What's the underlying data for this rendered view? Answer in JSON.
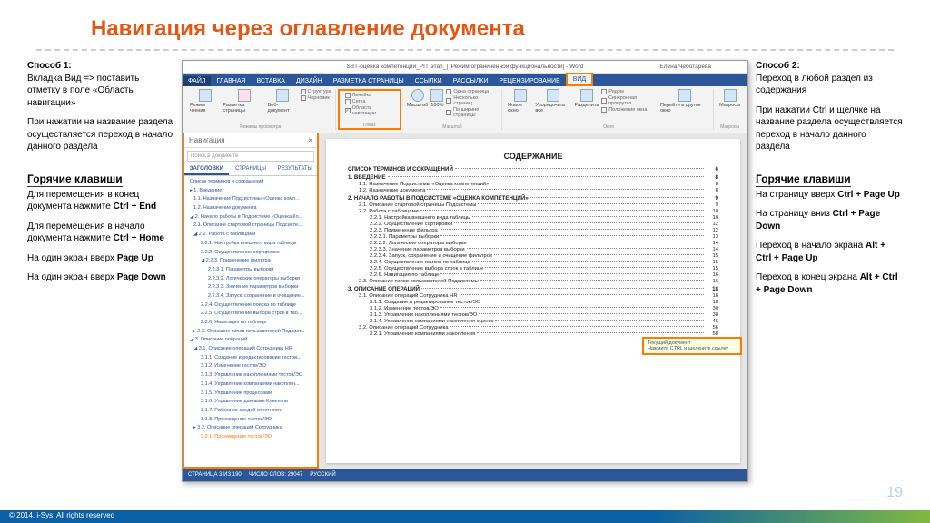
{
  "title": "Навигация через оглавление документа",
  "left": {
    "h1": "Способ 1:",
    "p1": "Вкладка Вид => поставить отметку в поле «Область навигации»",
    "p2": "При нажатии на название раздела осуществляется переход в начало данного раздела",
    "hk": "Горячие клавиши",
    "p3a": "Для перемещения в конец документа нажмите ",
    "p3b": "Ctrl + End",
    "p4a": "Для перемещения в начало документа нажмите ",
    "p4b": "Ctrl + Home",
    "p5a": "На один экран вверх ",
    "p5b": "Page Up",
    "p6a": "На один экран вверх ",
    "p6b": "Page Down"
  },
  "right": {
    "h1": "Способ 2:",
    "p1": "Переход в любой раздел из содержания",
    "p2": "При нажатии Ctrl и щелчке на название раздела осуществляется переход в начало данного раздела",
    "hk": "Горячие клавиши",
    "p3a": "На страницу вверх ",
    "p3b": "Ctrl + Page Up",
    "p4a": "На страницу вниз ",
    "p4b": "Ctrl + Page Down",
    "p5a": "Переход в начало экрана ",
    "p5b": "Alt + Ctrl + Page Up",
    "p6a": "Переход в конец экрана ",
    "p6b": "Alt + Ctrl + Page Down"
  },
  "word": {
    "title": "SBТ-оценка компетенций_РП [этап_] [Режим ограниченной функциональности] - Word",
    "user": "Елена Чеботарева",
    "tabs": [
      "ФАЙЛ",
      "ГЛАВНАЯ",
      "ВСТАВКА",
      "ДИЗАЙН",
      "РАЗМЕТКА СТРАНИЦЫ",
      "ССЫЛКИ",
      "РАССЫЛКИ",
      "РЕЦЕНЗИРОВАНИЕ",
      "ВИД"
    ],
    "group1_btns": [
      "Режим чтения",
      "Разметка страницы",
      "Веб-документ"
    ],
    "group1_checks": [
      "Структура",
      "Черновик"
    ],
    "group2_checks": [
      "Линейка",
      "Сетка",
      "Область навигации"
    ],
    "group2_label": "Показ",
    "group1_label": "Режимы просмотра",
    "zoom_label": "Масштаб",
    "zoom_btns": [
      "Масштаб",
      "100%"
    ],
    "page_checks": [
      "Одна страница",
      "Несколько страниц",
      "По ширине страницы"
    ],
    "window_btns": [
      "Новое окно",
      "Упорядочить все",
      "Разделить"
    ],
    "window_checks": [
      "Рядом",
      "Синхронная прокрутка",
      "Положение окна"
    ],
    "switch_btn": "Перейти в другое окно",
    "macros_btn": "Макросы",
    "window_label": "Окно",
    "macros_label": "Макросы",
    "nav": {
      "title": "Навигация",
      "close": "×",
      "search_ph": "Поиск в документе",
      "tabs": [
        "ЗАГОЛОВКИ",
        "СТРАНИЦЫ",
        "РЕЗУЛЬТАТЫ"
      ],
      "tree": [
        {
          "t": "Список терминов и сокращений",
          "l": 0
        },
        {
          "t": "▸ 1. Введение",
          "l": 0
        },
        {
          "t": "1.1. Назначение Подсистемы «Оценка комп...",
          "l": 1
        },
        {
          "t": "1.2. Назначение документа",
          "l": 1
        },
        {
          "t": "◢ 2. Начало работы в Подсистеме «Оценка Ко...",
          "l": 0
        },
        {
          "t": "2.1. Описание стартовой страницы Подсисте...",
          "l": 1
        },
        {
          "t": "◢ 2.2. Работа с таблицами",
          "l": 1
        },
        {
          "t": "2.2.1. Настройка внешнего вида таблицы",
          "l": 2
        },
        {
          "t": "2.2.2. Осуществление сортировки",
          "l": 2
        },
        {
          "t": "◢ 2.2.3. Применение фильтра",
          "l": 2
        },
        {
          "t": "2.2.3.1. Параметры выборки",
          "l": 3
        },
        {
          "t": "2.2.3.2. Логические операторы выборки",
          "l": 3
        },
        {
          "t": "2.2.3.3. Значение параметров выборки",
          "l": 3
        },
        {
          "t": "2.2.3.4. Запуск, сохранение и очищение...",
          "l": 3
        },
        {
          "t": "2.2.4. Осуществление поиска по таблице",
          "l": 2
        },
        {
          "t": "2.2.5. Осуществление выбора строк в таб...",
          "l": 2
        },
        {
          "t": "2.2.6. Навигация по таблице",
          "l": 2
        },
        {
          "t": "▸ 2.3. Описание типов пользователей Подсист...",
          "l": 1
        },
        {
          "t": "◢ 3. Описание операций",
          "l": 0
        },
        {
          "t": "◢ 3.1. Описание операций Сотрудника HR",
          "l": 1
        },
        {
          "t": "3.1.1. Создание и редактирование тестов...",
          "l": 2
        },
        {
          "t": "3.1.2. Изменение тестов/ЭО",
          "l": 2
        },
        {
          "t": "3.1.3. Управление накоплениями тестов/ЭО",
          "l": 2
        },
        {
          "t": "3.1.4. Управление компаниями накоплен...",
          "l": 2
        },
        {
          "t": "3.1.5. Управление процессами",
          "l": 2
        },
        {
          "t": "3.1.6. Управление данными Клиентов",
          "l": 2
        },
        {
          "t": "3.1.7. Работа со средой отчетности",
          "l": 2
        },
        {
          "t": "3.1.8. Прохождение тестов/ЭО",
          "l": 2
        },
        {
          "t": "▸ 3.2. Описание операций Сотрудника",
          "l": 1
        },
        {
          "t": "3.2.1. Прохождение тестов/ЭО",
          "l": 2,
          "sel": true
        }
      ]
    },
    "toc": {
      "heading": "СОДЕРЖАНИЕ",
      "lines": [
        {
          "t": "СПИСОК ТЕРМИНОВ И СОКРАЩЕНИЙ",
          "p": "6",
          "l": 1
        },
        {
          "t": "1. ВВЕДЕНИЕ",
          "p": "8",
          "l": 1
        },
        {
          "t": "1.1. Назначение Подсистемы «Оценка компетенций»",
          "p": "8",
          "l": 2
        },
        {
          "t": "1.2. Назначение документа",
          "p": "8",
          "l": 2
        },
        {
          "t": "2. НАЧАЛО РАБОТЫ В ПОДСИСТЕМЕ «ОЦЕНКА КОМПЕТЕНЦИЙ»",
          "p": "9",
          "l": 1
        },
        {
          "t": "2.1. Описание стартовой страницы Подсистемы",
          "p": "9",
          "l": 2
        },
        {
          "t": "2.2. Работа с таблицами",
          "p": "10",
          "l": 2
        },
        {
          "t": "2.2.1. Настройка внешнего вида таблицы",
          "p": "10",
          "l": 3
        },
        {
          "t": "2.2.2. Осуществление сортировки",
          "p": "12",
          "l": 3
        },
        {
          "t": "2.2.3. Применение фильтра",
          "p": "12",
          "l": 3
        },
        {
          "t": "2.2.3.1. Параметры выборки",
          "p": "13",
          "l": 3
        },
        {
          "t": "2.2.3.2. Логические операторы выборки",
          "p": "14",
          "l": 3
        },
        {
          "t": "2.2.3.3. Значение параметров выборки",
          "p": "14",
          "l": 3
        },
        {
          "t": "2.2.3.4. Запуск, сохранение и очищение фильтров",
          "p": "15",
          "l": 3
        },
        {
          "t": "2.2.4. Осуществление поиска по таблице",
          "p": "15",
          "l": 3
        },
        {
          "t": "2.2.5. Осуществление выбора строк в таблице",
          "p": "15",
          "l": 3
        },
        {
          "t": "2.2.6. Навигация по таблице",
          "p": "16",
          "l": 3
        },
        {
          "t": "2.3. Описание типов пользователей Подсистемы",
          "p": "16",
          "l": 2
        },
        {
          "t": "3. ОПИСАНИЕ ОПЕРАЦИЙ",
          "p": "18",
          "l": 1
        },
        {
          "t": "3.1. Описание операций Сотрудника HR",
          "p": "18",
          "l": 2
        },
        {
          "t": "3.1.1. Создание и редактирование тестов/ЭО",
          "p": "18",
          "l": 3
        },
        {
          "t": "3.1.2. Изменение тестов/ЭО",
          "p": "30",
          "l": 3
        },
        {
          "t": "3.1.3. Управление накоплениями тестов/ЭО",
          "p": "38",
          "l": 3
        },
        {
          "t": "3.1.4. Управление компаниями накопления оценок",
          "p": "46",
          "l": 3
        },
        {
          "t": "3.2. Описание операций Сотрудника",
          "p": "56",
          "l": 2
        },
        {
          "t": "3.2.1. Управление компаниями накопления",
          "p": "58",
          "l": 3
        }
      ]
    },
    "tooltip": {
      "l1": "Текущий документ",
      "l2": "Нажмите CTRL и щелкните ссылку"
    },
    "status": [
      "СТРАНИЦА 3 ИЗ 190",
      "ЧИСЛО СЛОВ: 29047",
      "РУССКИЙ"
    ]
  },
  "page_number": "19",
  "footer": "© 2014. i-Sys. All rights reserved"
}
